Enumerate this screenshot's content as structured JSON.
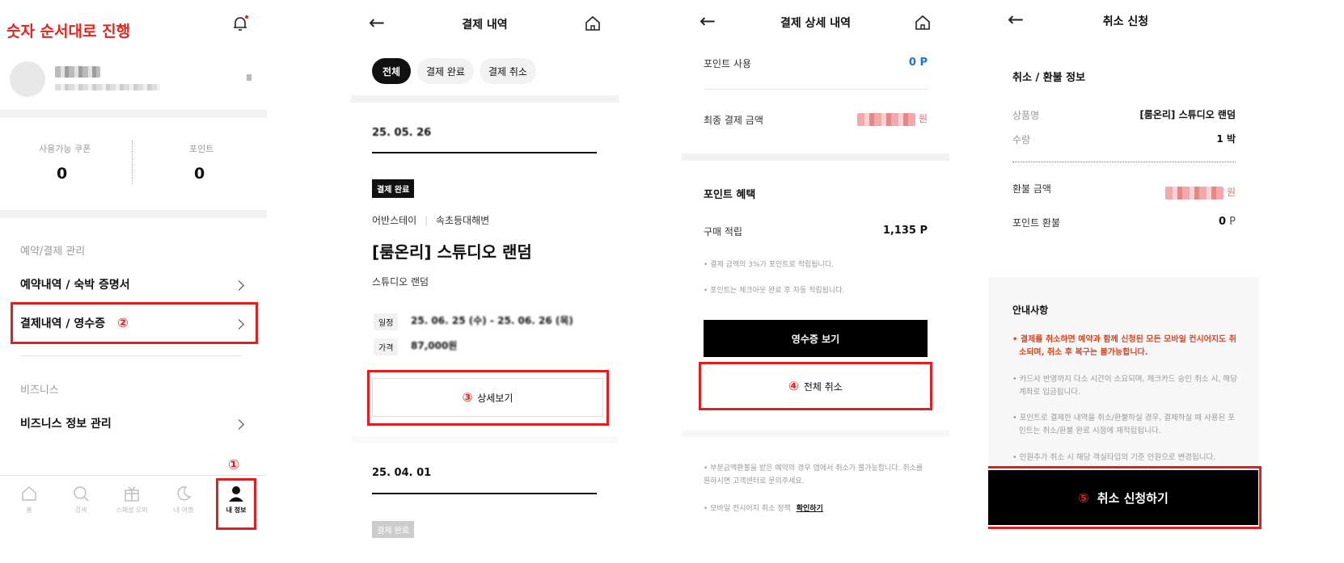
{
  "panel1": {
    "guide_title": "숫자 순서대로 진행",
    "coupon_label": "사용가능 쿠폰",
    "coupon_value": "0",
    "point_label": "포인트",
    "point_value": "0",
    "section1": "예약/결제 관리",
    "menu_reservations": "예약내역 / 숙박 증명서",
    "menu_payments": "결제내역 / 영수증",
    "menu_payments_step": "②",
    "section2": "비즈니스",
    "menu_business": "비즈니스 정보 관리",
    "tabbar": [
      {
        "label": "홈",
        "icon": "home-icon"
      },
      {
        "label": "검색",
        "icon": "search-icon"
      },
      {
        "label": "스페셜 오퍼",
        "icon": "gift-icon"
      },
      {
        "label": "내 여행",
        "icon": "moon-icon"
      },
      {
        "label": "내 정보",
        "icon": "person-icon"
      }
    ],
    "step1": "①"
  },
  "panel2": {
    "title": "결제 내역",
    "filters": [
      "전체",
      "결제 완료",
      "결제 취소"
    ],
    "date1": "25. 05. 26",
    "status_tag": "결제 완료",
    "brand": "어반스테이",
    "location": "속초등대해변",
    "product": "[룸온리] 스튜디오 랜덤",
    "room": "스튜디오 랜덤",
    "schedule_label": "일정",
    "schedule_value": "25. 06. 25 (수) - 25. 06. 26 (목)",
    "price_label": "가격",
    "price_value": "87,000원",
    "detail_step": "③",
    "detail_button": "상세보기",
    "date2": "25. 04. 01",
    "status_tag2": "결제 완료"
  },
  "panel3": {
    "title": "결제 상세 내역",
    "point_use_label": "포인트 사용",
    "point_use_value": "0 P",
    "final_amount_label": "최종 결제 금액",
    "currency": "원",
    "benefit_title": "포인트 혜택",
    "purchase_point_label": "구매 적립",
    "purchase_point_value": "1,135 P",
    "note1": "결제 금액의 3%가 포인트로 적립됩니다.",
    "note2": "포인트는 체크아웃 완료 후 자동 적립됩니다.",
    "receipt_button": "영수증 보기",
    "cancel_step": "④",
    "cancel_all_button": "전체 취소",
    "bottom_note1": "부분금액환불을 받은 예약의 경우 앱에서 취소가 불가능합니다. 취소를 원하시면 고객센터로 문의주세요.",
    "bottom_note2": "모바일 컨시어지 취소 정책",
    "bottom_link": "확인하기"
  },
  "panel4": {
    "title": "취소 신청",
    "section_title": "취소 / 환불 정보",
    "product_label": "상품명",
    "product_value": "[룸온리] 스튜디오 랜덤",
    "qty_label": "수량",
    "qty_value": "1 박",
    "refund_label": "환불 금액",
    "currency": "원",
    "point_refund_label": "포인트 환불",
    "point_refund_value": "0",
    "point_unit": "P",
    "notice_title": "안내사항",
    "notice_warn": "결제를 취소하면 예약과 함께 신청된 모든 모바일 컨시어지도 취소되며, 취소 후 복구는 불가능합니다.",
    "notice2": "카드사 반영까지 다소 시간이 소요되며, 체크카드 승인 취소 시, 해당 계좌로 입금됩니다.",
    "notice3": "포인트로 결제한 내역을 취소/환불하실 경우, 결제하실 때 사용된 포인트는 취소/환불 완료 시점에 재적립됩니다.",
    "notice4": "인원추가 취소 시 해당 객실타입의 기준 인원으로 변경됩니다.",
    "submit_step": "⑤",
    "submit_button": "취소 신청하기"
  },
  "colors": {
    "accent_red": "#e02020",
    "blue": "#1e6fd9",
    "black": "#000000"
  }
}
